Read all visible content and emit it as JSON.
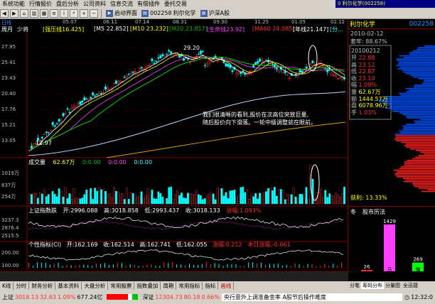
{
  "menu": {
    "items": [
      "系统功能",
      "行情报价",
      "盘后分析",
      "公司资料",
      "信息交流",
      "有偿插件",
      "委托交易"
    ],
    "ticker": "0 利尔化学(002258)"
  },
  "toolbar": {
    "start_screen": "启动界面",
    "stock_code_btn": "002258",
    "stock_name_btn": "利尔化学",
    "index_btn": "沪深A股"
  },
  "chart": {
    "period_label": "日线",
    "cycle_label": "周月",
    "fq_label": "少将",
    "dates": [
      "05.07",
      "06.11",
      "07.14",
      "08.31",
      "09.30",
      "11.25",
      "01.05",
      "02.12"
    ],
    "legend": {
      "ma_main": "[强压线16.425]",
      "ma5": "[M5 22.852]",
      "ma10": "[M10 23.232]",
      "ma20": "[M20 23.817]",
      "ma_life": "[生命线23.92]",
      "ma60": "[MA60 24.085]",
      "year_line": "[年线21.147]",
      "ma_short": "[分..."
    },
    "price_ticks": [
      "27.95",
      "25.41",
      "23.43",
      "20.40",
      "17.76",
      "15.21",
      "13.05"
    ],
    "high_label": "29.20",
    "low_label": "12.97",
    "note_line1": "我们很清晰的看到,股价在次高位突放巨量,",
    "note_line2": "随后股价向下滑落。一轮中级调整就在眼前。",
    "volume_label": "成交量",
    "volume_value": "62.67万",
    "volume_zero1": "0:0.00",
    "volume_zero2": "0:0.00",
    "volume_zero3": "0:0.00",
    "volume_ticks": [
      "1019万",
      "637万",
      "254万"
    ],
    "index_panel": {
      "name": "上证指数跌",
      "open": "开:2996.088",
      "high": "高:3018.858",
      "low": "低:2993.437",
      "close": "收:3018.133",
      "change": "涨幅:1.093%",
      "ticks": [
        "3237.3",
        "2876.4",
        "2515.5"
      ]
    },
    "ci_panel": {
      "name": "个性指标(CI)",
      "open": "开:162.169",
      "close_a": "收:162.514",
      "high": "高:162.741",
      "low": "低:162.055",
      "change": "涨幅:0.212",
      "day_change": "本日涨幅:-0.061",
      "ticks": [
        "200.00",
        "100.00"
      ]
    }
  },
  "right_panel": {
    "stock_name": "利尔化学",
    "stock_code": "002258",
    "date": "2010-02-12",
    "trapped": "套牢: 88.67%",
    "day": "20100212",
    "stats": [
      {
        "k": "开",
        "v": "22.88"
      },
      {
        "k": "高",
        "v": "23.12"
      },
      {
        "k": "低",
        "v": "22.87"
      },
      {
        "k": "收",
        "v": "23.10"
      },
      {
        "k": "幅",
        "v": "1.09%"
      },
      {
        "k": "量",
        "v": "62.67万"
      },
      {
        "k": "额",
        "v": "1444.57万"
      },
      {
        "k": "盘",
        "v": "6078.96万"
      },
      {
        "k": "手",
        "v": "1.03%"
      }
    ],
    "profit": "获利: 13.33%",
    "history_title": "股市历法",
    "history_season": "冬",
    "history_bars": [
      {
        "label": "午",
        "value": 26
      },
      {
        "label": "马",
        "value": 1429
      },
      {
        "label": "猴",
        "value": 269
      }
    ],
    "tabs": [
      "分笔",
      "筹码分布",
      "分量图",
      "全迅捷"
    ]
  },
  "bottom_tabs": [
    "K线",
    "分时",
    "财务分析",
    "基本资料",
    "大盘分析",
    "常用股票",
    "指数叠加",
    "周期",
    "常用指标",
    "指标",
    "画线"
  ],
  "status": {
    "sh_label": "上证",
    "sh_value": "3018.13",
    "sh_change": "32.63",
    "sh_pct": "1.09%",
    "sh_amount": "677.24亿",
    "sz_label": "深证",
    "sz_value": "12304.73",
    "sz_change": "80.18",
    "sz_pct": "0.66%",
    "news": "央行意外上调准备金率 A股节后操作难度",
    "time": "12:32:0"
  },
  "colors": {
    "up": "#ff3030",
    "down": "#00c000",
    "ma_white": "#ffffff",
    "ma_yellow": "#ffff00",
    "ma_magenta": "#ff40ff",
    "ma_green": "#00ff00",
    "longline": "#c0d0ff",
    "year_line": "#e0a000"
  }
}
